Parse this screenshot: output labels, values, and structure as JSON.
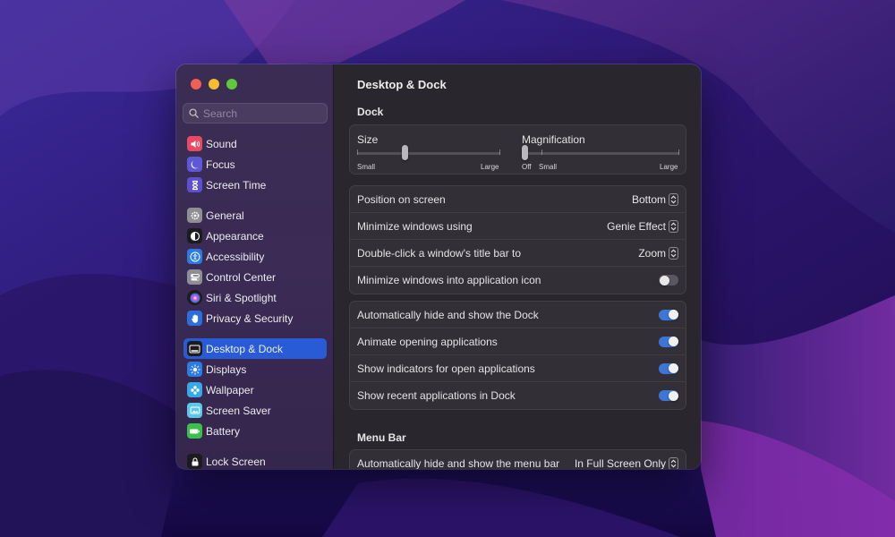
{
  "window": {
    "title": "Desktop & Dock"
  },
  "sidebar": {
    "search_placeholder": "Search",
    "items": [
      {
        "label": "Sound",
        "icon": "speaker-icon",
        "color": "#e84a66"
      },
      {
        "label": "Focus",
        "icon": "moon-icon",
        "color": "#5f58d6"
      },
      {
        "label": "Screen Time",
        "icon": "hourglass-icon",
        "color": "#5d4fd1"
      },
      {
        "label": "General",
        "icon": "gear-icon",
        "color": "#8e8e93"
      },
      {
        "label": "Appearance",
        "icon": "appearance-icon",
        "color": "#1c1c1e"
      },
      {
        "label": "Accessibility",
        "icon": "accessibility-icon",
        "color": "#2a7be4"
      },
      {
        "label": "Control Center",
        "icon": "control-center-icon",
        "color": "#8e8e93"
      },
      {
        "label": "Siri & Spotlight",
        "icon": "siri-icon",
        "color": "#1c1c1e"
      },
      {
        "label": "Privacy & Security",
        "icon": "hand-icon",
        "color": "#2a6fe0"
      },
      {
        "label": "Desktop & Dock",
        "icon": "dock-icon",
        "color": "#1c1c1e",
        "active": true
      },
      {
        "label": "Displays",
        "icon": "sun-icon",
        "color": "#2a7be4"
      },
      {
        "label": "Wallpaper",
        "icon": "flower-icon",
        "color": "#38a9e8"
      },
      {
        "label": "Screen Saver",
        "icon": "screen-saver-icon",
        "color": "#5ac8e8"
      },
      {
        "label": "Battery",
        "icon": "battery-icon",
        "color": "#38c24a"
      },
      {
        "label": "Lock Screen",
        "icon": "lock-icon",
        "color": "#1c1c1e"
      }
    ]
  },
  "dock": {
    "section_title": "Dock",
    "size": {
      "label": "Size",
      "min_label": "Small",
      "max_label": "Large",
      "value": 0.33
    },
    "magnification": {
      "label": "Magnification",
      "off_label": "Off",
      "min_label": "Small",
      "max_label": "Large",
      "value": 0.0
    },
    "settings": [
      {
        "label": "Position on screen",
        "type": "popup",
        "value": "Bottom"
      },
      {
        "label": "Minimize windows using",
        "type": "popup",
        "value": "Genie Effect"
      },
      {
        "label": "Double-click a window's title bar to",
        "type": "popup",
        "value": "Zoom"
      },
      {
        "label": "Minimize windows into application icon",
        "type": "toggle",
        "on": false
      }
    ],
    "toggles": [
      {
        "label": "Automatically hide and show the Dock",
        "on": true
      },
      {
        "label": "Animate opening applications",
        "on": true
      },
      {
        "label": "Show indicators for open applications",
        "on": true
      },
      {
        "label": "Show recent applications in Dock",
        "on": true
      }
    ]
  },
  "menu_bar": {
    "section_title": "Menu Bar",
    "settings": [
      {
        "label": "Automatically hide and show the menu bar",
        "type": "popup",
        "value": "In Full Screen Only"
      }
    ]
  },
  "colors": {
    "accent": "#2a5bd7",
    "toggle_on": "#3c76d6",
    "close": "#ee5f57",
    "minimize": "#f5bc2f",
    "maximize": "#5fc73d"
  }
}
